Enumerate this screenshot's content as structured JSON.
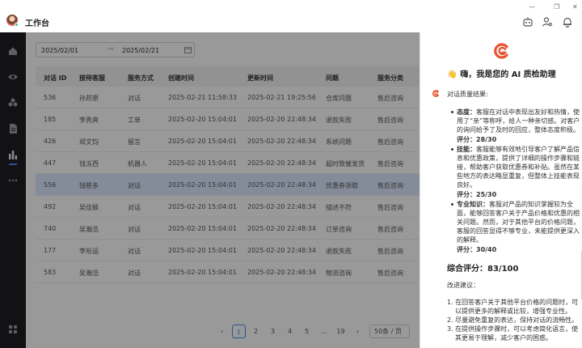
{
  "app": {
    "title": "工作台"
  },
  "window": {
    "minimize": "—",
    "restore": "❐",
    "close": "✕"
  },
  "filter": {
    "start_date": "2025/02/01",
    "arrow": "→",
    "end_date": "2025/02/21"
  },
  "table": {
    "columns": [
      "对话 ID",
      "接待客服",
      "服务方式",
      "创建时间",
      "更新时间",
      "问题",
      "服务分类"
    ],
    "rows": [
      [
        "536",
        "孙邦原",
        "对话",
        "2025-02-21 11:58:33",
        "2025-02-21 19:25:56",
        "仓库问题",
        "售后咨询"
      ],
      [
        "185",
        "李秀爽",
        "工单",
        "2025-02-20 15:04:01",
        "2025-02-20 22:48:34",
        "退款失败",
        "售后咨询"
      ],
      [
        "426",
        "郑文钧",
        "留言",
        "2025-02-20 15:04:01",
        "2025-02-20 22:48:34",
        "系统问题",
        "售后咨询"
      ],
      [
        "447",
        "钱冻西",
        "机器人",
        "2025-02-20 15:04:01",
        "2025-02-20 22:48:34",
        "超时致催发货",
        "售后咨询"
      ],
      [
        "556",
        "钱慈多",
        "对话",
        "2025-02-20 15:04:01",
        "2025-02-20 22:48:34",
        "优惠券领取",
        "售后咨询"
      ],
      [
        "492",
        "吴佳颖",
        "对话",
        "2025-02-20 15:04:01",
        "2025-02-20 22:48:34",
        "描述不符",
        "售后咨询"
      ],
      [
        "740",
        "吴瀚浩",
        "对话",
        "2025-02-20 15:04:01",
        "2025-02-20 22:48:34",
        "订单咨询",
        "售后咨询"
      ],
      [
        "177",
        "李彤运",
        "对话",
        "2025-02-20 15:04:01",
        "2025-02-20 22:48:34",
        "退款失败",
        "售后咨询"
      ],
      [
        "583",
        "吴瀚浩",
        "对话",
        "2025-02-20 15:04:01",
        "2025-02-20 22:48:34",
        "物流咨询",
        "售后咨询"
      ]
    ],
    "selected_row": 4
  },
  "pagination": {
    "prev": "‹",
    "pages": [
      "1",
      "2",
      "3",
      "4",
      "5",
      "...",
      "19"
    ],
    "next": "›",
    "page_size": "50条 / 页",
    "current": "1"
  },
  "ai_panel": {
    "greeting": "👋 嗨，我是您的 AI 质检助理",
    "result_label": "对话质量结果:",
    "attitude": {
      "label": "态度：",
      "lines": [
        "客服在对话中表现出友好和热情，使",
        "用了“亲”等称呼，给人一种亲切感。对客户",
        "的询问给予了及时的回应，整体态度积极。"
      ],
      "score": "评分：28/30"
    },
    "skill": {
      "label": "技能：",
      "lines": [
        "客服能够有效地引导客户了解产品信",
        "息和优惠政策，提供了详细的操作步骤和链",
        "接，帮助客户获取优惠券和补贴。虽然在某",
        "些地方的表达略显重复，但整体上技能表现",
        "良好。"
      ],
      "score": "评分：25/30"
    },
    "knowledge": {
      "label": "专业知识：",
      "lines": [
        "客服对产品的知识掌握较为全",
        "面，能够回答客户关于产品价格和优惠的相",
        "关问题。然而，对于其他平台的价格问题，",
        "客服的回答显得不够专业，未能提供更深入",
        "的解释。"
      ],
      "score": "评分：30/40"
    },
    "total": "综合评分：83/100",
    "suggest_label": "改进建议：",
    "suggestions": [
      [
        "1. 在回答客户关于其他平台价格的问题时，可",
        "以提供更多的解释或比较，增强专业性。"
      ],
      [
        "2. 尽量避免重复的表达，保持对话的流畅性。"
      ],
      [
        "3. 在提供操作步骤时，可以考虑简化语言，使",
        "其更易于理解，减少客户的困惑。"
      ]
    ]
  },
  "colors": {
    "accent": "#4b8bf5",
    "brand": "#e8532f",
    "sidebar": "#1e1f22",
    "selected_row": "#dce8ff"
  }
}
